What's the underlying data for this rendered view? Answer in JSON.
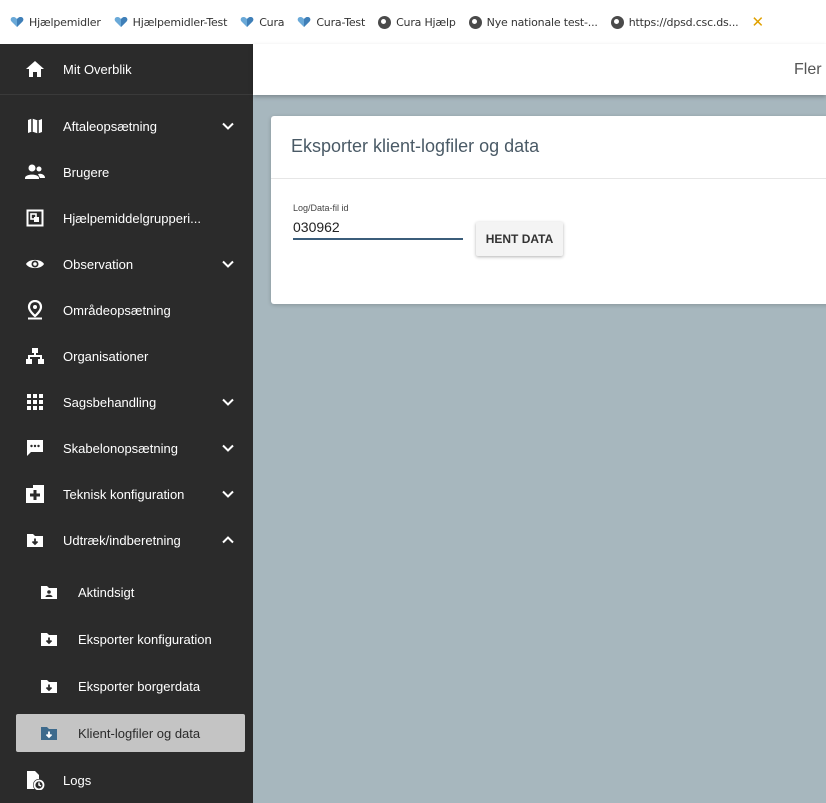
{
  "bookmarks": [
    {
      "label": "Hjælpemidler",
      "icon": "heart-icon"
    },
    {
      "label": "Hjælpemidler-Test",
      "icon": "heart-icon"
    },
    {
      "label": "Cura",
      "icon": "heart-icon"
    },
    {
      "label": "Cura-Test",
      "icon": "heart-icon"
    },
    {
      "label": "Cura Hjælp",
      "icon": "globe-icon"
    },
    {
      "label": "Nye nationale test-...",
      "icon": "globe-icon"
    },
    {
      "label": "https://dpsd.csc.ds...",
      "icon": "globe-icon"
    }
  ],
  "topbar": {
    "title": "Fler"
  },
  "sidebar": {
    "home_label": "Mit Overblik",
    "items": [
      {
        "label": "Aftaleopsætning",
        "icon": "map-icon",
        "expandable": true
      },
      {
        "label": "Brugere",
        "icon": "users-icon",
        "expandable": false
      },
      {
        "label": "Hjælpemiddelgrupperi...",
        "icon": "group-icon",
        "expandable": false
      },
      {
        "label": "Observation",
        "icon": "eye-icon",
        "expandable": true
      },
      {
        "label": "Områdeopsætning",
        "icon": "location-pin-icon",
        "expandable": false
      },
      {
        "label": "Organisationer",
        "icon": "sitemap-icon",
        "expandable": false
      },
      {
        "label": "Sagsbehandling",
        "icon": "grid-icon",
        "expandable": true
      },
      {
        "label": "Skabelonopsætning",
        "icon": "chat-icon",
        "expandable": true
      },
      {
        "label": "Teknisk konfiguration",
        "icon": "medical-building-icon",
        "expandable": true
      },
      {
        "label": "Udtræk/indberetning",
        "icon": "folder-download-icon",
        "expandable": true,
        "expanded": true
      }
    ],
    "subitems": [
      {
        "label": "Aktindsigt",
        "icon": "folder-person-icon"
      },
      {
        "label": "Eksporter konfiguration",
        "icon": "folder-download-icon"
      },
      {
        "label": "Eksporter borgerdata",
        "icon": "folder-download-icon"
      },
      {
        "label": "Klient-logfiler og data",
        "icon": "folder-download-icon",
        "active": true
      }
    ],
    "logs_label": "Logs"
  },
  "card": {
    "title": "Eksporter klient-logfiler og data",
    "field_label": "Log/Data-fil id",
    "field_value": "030962",
    "button_label": "HENT DATA"
  },
  "colors": {
    "sidebar_bg": "#2b2b2b",
    "content_bg": "#a7b7be",
    "active_item_bg": "#c4c4c4",
    "input_underline": "#3b5d7a"
  }
}
